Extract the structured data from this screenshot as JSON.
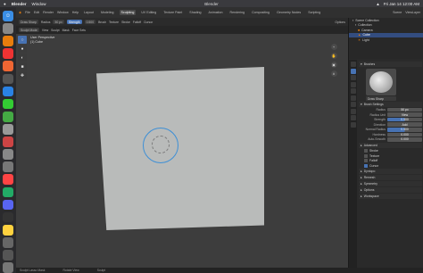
{
  "menubar": {
    "app": "Blender",
    "items": [
      "Window"
    ],
    "title": "Blender",
    "clock": "Fri Jan 14  12:00 AM"
  },
  "workspaces": [
    "Layout",
    "Modeling",
    "Sculpting",
    "UV Editing",
    "Texture Paint",
    "Shading",
    "Animation",
    "Rendering",
    "Compositing",
    "Geometry Nodes",
    "Scripting"
  ],
  "active_workspace": "Sculpting",
  "file_menu": [
    "File",
    "Edit",
    "Render",
    "Window",
    "Help"
  ],
  "scene": {
    "label": "Scene",
    "layer": "ViewLayer"
  },
  "tool_header": {
    "tool": "Draw Sharp",
    "radius_label": "Radius",
    "radius_value": "50 px",
    "strength_label": "Strength",
    "strength_value": "0.500",
    "brush": "Brush",
    "texture": "Texture",
    "stroke": "Stroke",
    "falloff": "Falloff",
    "cursor": "Cursor",
    "options": "Options"
  },
  "mode_header": {
    "mode": "Sculpt Mode",
    "view": "View",
    "sculpt": "Sculpt",
    "mask": "Mask",
    "face_sets": "Face Sets"
  },
  "viewport": {
    "line1": "User Perspective",
    "line2": "(1) Cube"
  },
  "outliner": {
    "items": [
      "Scene Collection",
      "Collection",
      "Camera",
      "Cube",
      "Light"
    ],
    "selected": 3
  },
  "properties": {
    "brushes_header": "Brushes",
    "brush_name": "Draw Sharp",
    "settings_header": "Brush Settings",
    "rows": [
      {
        "label": "Radius",
        "value": "50 px",
        "style": "gray"
      },
      {
        "label": "Radius Unit",
        "value": "View",
        "style": "gray"
      },
      {
        "label": "Strength",
        "value": "0.500",
        "style": "half"
      },
      {
        "label": "Direction",
        "value": "Add",
        "style": "gray"
      },
      {
        "label": "Normal Radius",
        "value": "0.500",
        "style": "half"
      },
      {
        "label": "Hardness",
        "value": "0.000",
        "style": "gray"
      },
      {
        "label": "Auto-Smooth",
        "value": "0.000",
        "style": "gray"
      }
    ],
    "advanced": "Advanced",
    "checks": [
      "Stroke",
      "Texture",
      "Falloff",
      "Cursor"
    ],
    "sections": [
      "Dyntopo",
      "Remesh",
      "Symmetry",
      "Options",
      "Workspace"
    ]
  },
  "statusbar": {
    "a": "Sculpt Lasso Mask",
    "b": "Rotate View",
    "c": "Sculpt"
  }
}
